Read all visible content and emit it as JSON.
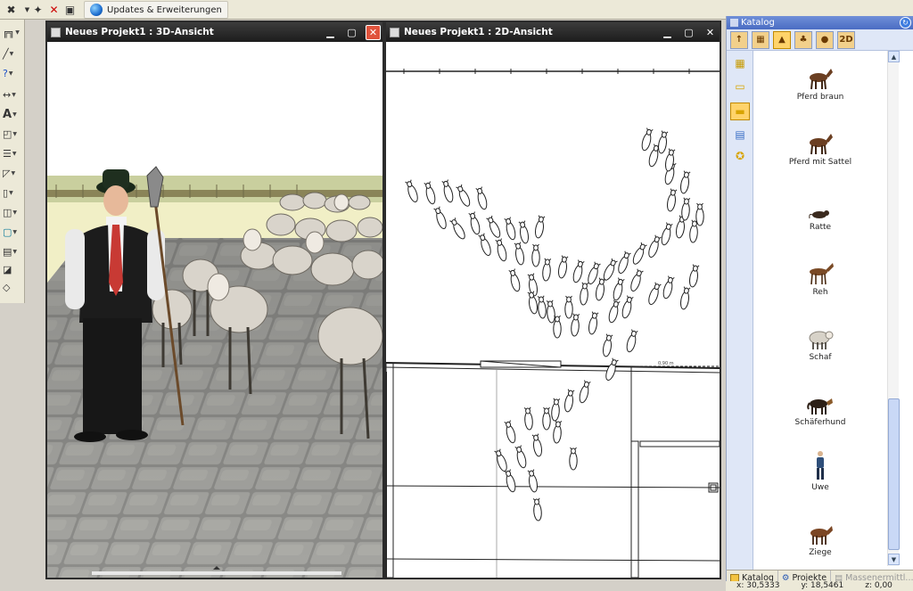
{
  "toolbar": {
    "updates_label": "Updates & Erweiterungen"
  },
  "window_3d": {
    "title": "Neues Projekt1 : 3D-Ansicht"
  },
  "window_2d": {
    "title": "Neues Projekt1 : 2D-Ansicht",
    "dimension_label": "0,90 m"
  },
  "catalog": {
    "title": "Katalog",
    "items": [
      {
        "label": "Pferd braun",
        "icon": "horse-icon"
      },
      {
        "label": "Pferd mit Sattel",
        "icon": "horse-icon"
      },
      {
        "label": "Ratte",
        "icon": "rat-icon"
      },
      {
        "label": "Reh",
        "icon": "deer-icon"
      },
      {
        "label": "Schaf",
        "icon": "sheep-icon"
      },
      {
        "label": "Schäferhund",
        "icon": "dog-icon"
      },
      {
        "label": "Uwe",
        "icon": "person-icon"
      },
      {
        "label": "Ziege",
        "icon": "goat-icon"
      }
    ],
    "tabs": {
      "2d_label": "2D"
    },
    "bottom_tabs": [
      "Katalog",
      "Projekte",
      "Massenermittl..."
    ]
  },
  "status": {
    "x": "x: 30,5333",
    "y": "y: 18,5461",
    "z": "z: 0,00"
  },
  "colors": {
    "titlebar": "#2b2b2b",
    "catalog_title": "#5577cc",
    "accent_yellow": "#ffd36a"
  }
}
